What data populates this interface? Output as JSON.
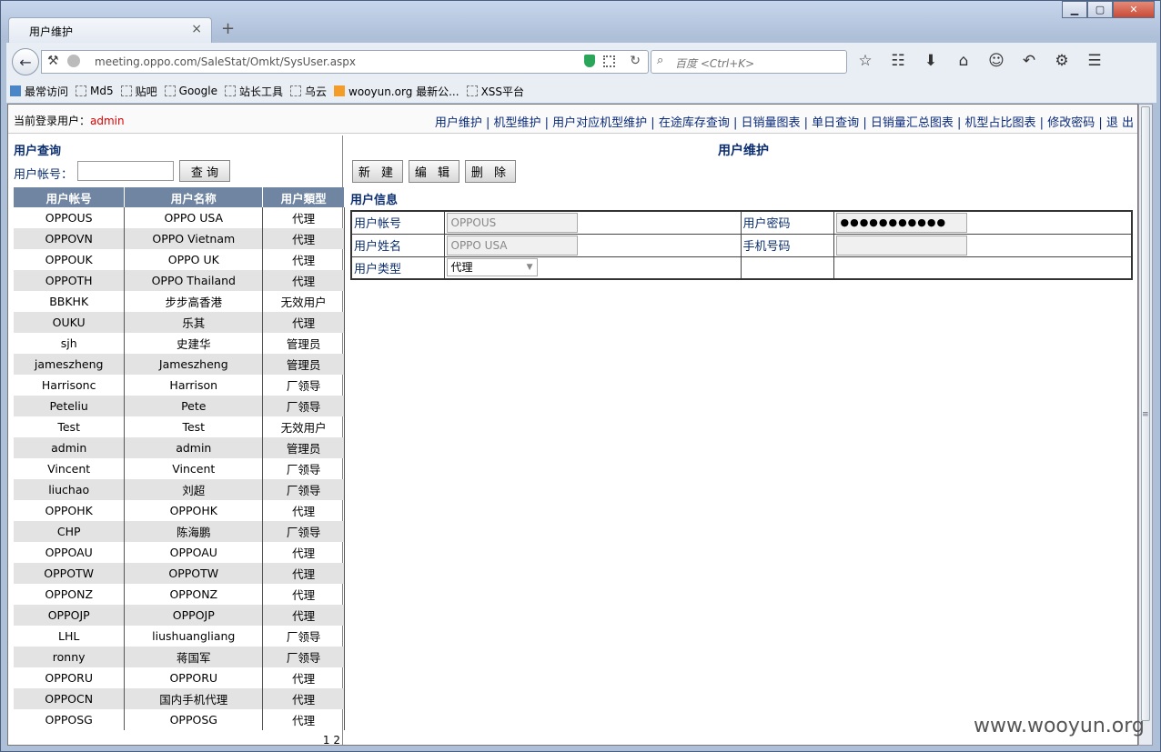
{
  "browser": {
    "tab_title": "用户维护",
    "tab_close": "×",
    "new_tab": "+",
    "win_min": "▁",
    "win_max": "▢",
    "win_close": "✕",
    "url": "meeting.oppo.com/SaleStat/Omkt/SysUser.aspx",
    "search_placeholder": "百度 <Ctrl+K>",
    "icons": [
      "back-icon",
      "key-icon",
      "globe-icon",
      "shield-icon",
      "qr-icon",
      "reload-icon",
      "search-icon",
      "star-icon",
      "reader-icon",
      "download-icon",
      "home-icon",
      "chat-icon",
      "undo-icon",
      "addon-icon",
      "menu-icon"
    ],
    "bookmarks": [
      "最常访问",
      "Md5",
      "贴吧",
      "Google",
      "站长工具",
      "乌云",
      "wooyun.org 最新公...",
      "XSS平台"
    ]
  },
  "header": {
    "login_label": "当前登录用户：",
    "login_user": "admin",
    "menu": [
      "用户维护",
      "机型维护",
      "用户对应机型维护",
      "在途库存查询",
      "日销量图表",
      "单日查询",
      "日销量汇总图表",
      "机型占比图表",
      "修改密码",
      "退 出"
    ]
  },
  "query": {
    "title": "用户查询",
    "account_label": "用户帐号：",
    "account_value": "",
    "query_button": "查 询"
  },
  "users_table": {
    "columns": [
      "用户帐号",
      "用户名称",
      "用户類型"
    ],
    "rows": [
      [
        "OPPOUS",
        "OPPO USA",
        "代理"
      ],
      [
        "OPPOVN",
        "OPPO Vietnam",
        "代理"
      ],
      [
        "OPPOUK",
        "OPPO UK",
        "代理"
      ],
      [
        "OPPOTH",
        "OPPO Thailand",
        "代理"
      ],
      [
        "BBKHK",
        "步步高香港",
        "无效用户"
      ],
      [
        "OUKU",
        "乐其",
        "代理"
      ],
      [
        "sjh",
        "史建华",
        "管理员"
      ],
      [
        "jameszheng",
        "Jameszheng",
        "管理员"
      ],
      [
        "Harrisonc",
        "Harrison",
        "厂领导"
      ],
      [
        "Peteliu",
        "Pete",
        "厂领导"
      ],
      [
        "Test",
        "Test",
        "无效用户"
      ],
      [
        "admin",
        "admin",
        "管理员"
      ],
      [
        "Vincent",
        "Vincent",
        "厂领导"
      ],
      [
        "liuchao",
        "刘超",
        "厂领导"
      ],
      [
        "OPPOHK",
        "OPPOHK",
        "代理"
      ],
      [
        "CHP",
        "陈海鹏",
        "厂领导"
      ],
      [
        "OPPOAU",
        "OPPOAU",
        "代理"
      ],
      [
        "OPPOTW",
        "OPPOTW",
        "代理"
      ],
      [
        "OPPONZ",
        "OPPONZ",
        "代理"
      ],
      [
        "OPPOJP",
        "OPPOJP",
        "代理"
      ],
      [
        "LHL",
        "liushuangliang",
        "厂领导"
      ],
      [
        "ronny",
        "蒋国军",
        "厂领导"
      ],
      [
        "OPPORU",
        "OPPORU",
        "代理"
      ],
      [
        "OPPOCN",
        "国内手机代理",
        "代理"
      ],
      [
        "OPPOSG",
        "OPPOSG",
        "代理"
      ]
    ],
    "pager": "1 2"
  },
  "maintenance": {
    "title": "用户维护",
    "new_button": "新 建",
    "edit_button": "编 辑",
    "delete_button": "删 除",
    "info_title": "用户信息",
    "account_label": "用户帐号",
    "account_value": "OPPOUS",
    "password_label": "用户密码",
    "password_value": "●●●●●●●●●●●",
    "name_label": "用户姓名",
    "name_value": "OPPO USA",
    "phone_label": "手机号码",
    "phone_value": "",
    "type_label": "用户类型",
    "type_value": "代理"
  },
  "watermark": "www.wooyun.org"
}
